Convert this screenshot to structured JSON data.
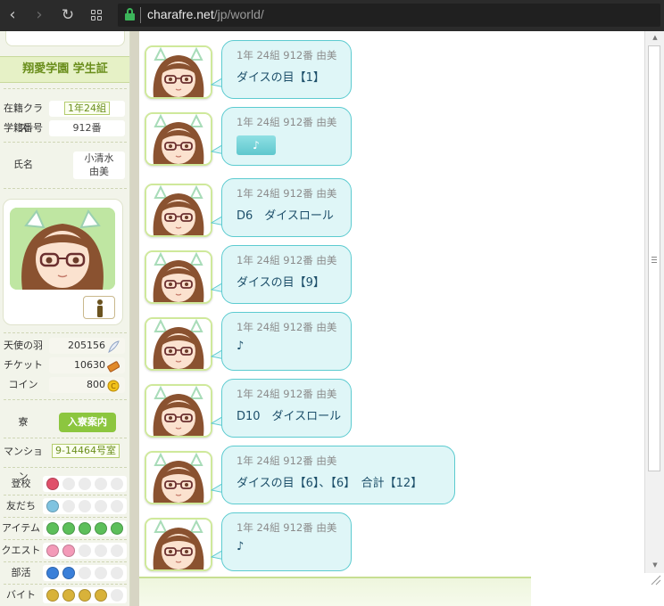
{
  "browser": {
    "url_host": "charafre.net",
    "url_path": "/jp/world/"
  },
  "sidebar": {
    "title": "翔愛学園 学生証",
    "class_label": "在籍クラス",
    "class_value": "1年24組",
    "student_no_label": "学籍番号",
    "student_no_value": "912番",
    "name_label": "氏名",
    "name_line1": "小清水",
    "name_line2": "由美",
    "resources": [
      {
        "label": "天使の羽",
        "value": "205156",
        "icon": "angel-feather-icon"
      },
      {
        "label": "チケット",
        "value": "10630",
        "icon": "ticket-icon"
      },
      {
        "label": "コイン",
        "value": "800",
        "icon": "coin-icon"
      }
    ],
    "dorm_label": "寮",
    "dorm_button": "入寮案内",
    "mansion_label": "マンション",
    "mansion_value": "9-14464号室",
    "badges": [
      {
        "label": "登校",
        "filled": 1,
        "color": "#e0506a"
      },
      {
        "label": "友だち",
        "filled": 1,
        "color": "#7fc3e0"
      },
      {
        "label": "アイテム",
        "filled": 5,
        "color": "#5cbf5a"
      },
      {
        "label": "クエスト",
        "filled": 2,
        "color": "#f39ab8"
      },
      {
        "label": "部活",
        "filled": 2,
        "color": "#3a7fd9"
      },
      {
        "label": "バイト",
        "filled": 4,
        "color": "#d8b23a"
      }
    ]
  },
  "chat": {
    "messages": [
      {
        "sender": "1年 24組 912番 由美",
        "text": "ダイスの目【1】",
        "music": false
      },
      {
        "sender": "1年 24組 912番 由美",
        "text": "♪",
        "music": true
      },
      {
        "sender": "1年 24組 912番 由美",
        "text": "D6　ダイスロール",
        "music": false
      },
      {
        "sender": "1年 24組 912番 由美",
        "text": "ダイスの目【9】",
        "music": false
      },
      {
        "sender": "1年 24組 912番 由美",
        "text": "♪",
        "music": false
      },
      {
        "sender": "1年 24組 912番 由美",
        "text": "D10　ダイスロール",
        "music": false
      },
      {
        "sender": "1年 24組 912番 由美",
        "text": "ダイスの目【6】、【6】　合計【12】",
        "music": false
      },
      {
        "sender": "1年 24組 912番 由美",
        "text": "♪",
        "music": false
      }
    ]
  },
  "colors": {
    "bubble_bg": "#dff6f7",
    "bubble_border": "#5ccbd0",
    "accent_green": "#8cc63f"
  }
}
